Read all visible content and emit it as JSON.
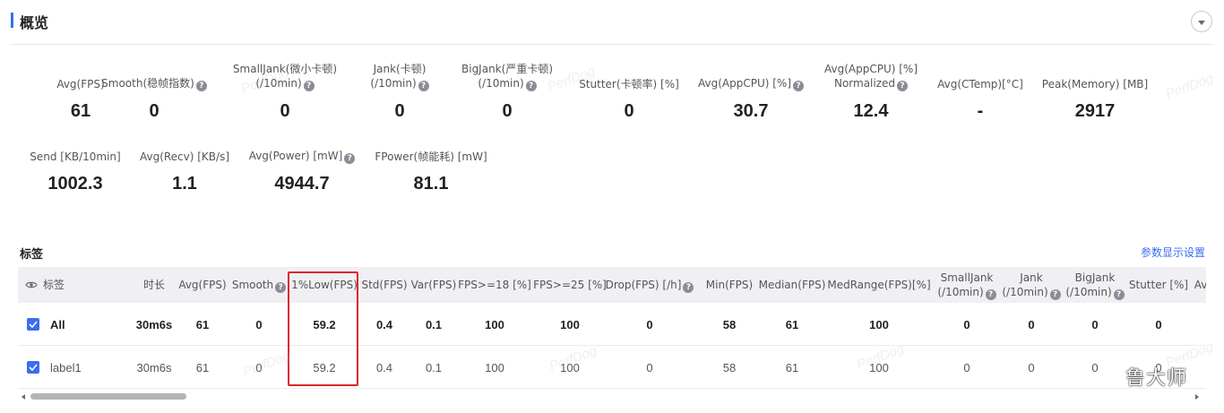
{
  "header": {
    "title": "概览"
  },
  "watermark": "PerfDog",
  "brand_mark": "鲁大师",
  "overview": {
    "row1": [
      {
        "label": [
          "Avg(FPS)"
        ],
        "help": false,
        "value": "61"
      },
      {
        "label": [
          "Smooth(稳帧指数)"
        ],
        "help": true,
        "value": "0"
      },
      {
        "label": [
          "SmallJank(微小卡顿)",
          "(/10min)"
        ],
        "help": true,
        "value": "0"
      },
      {
        "label": [
          "Jank(卡顿)",
          "(/10min)"
        ],
        "help": true,
        "value": "0"
      },
      {
        "label": [
          "BigJank(严重卡顿)",
          "(/10min)"
        ],
        "help": true,
        "value": "0"
      },
      {
        "label": [
          "Stutter(卡顿率) [%]"
        ],
        "help": false,
        "value": "0"
      },
      {
        "label": [
          "Avg(AppCPU) [%]"
        ],
        "help": true,
        "value": "30.7"
      },
      {
        "label": [
          "Avg(AppCPU) [%]",
          "Normalized"
        ],
        "help": true,
        "value": "12.4"
      },
      {
        "label": [
          "Avg(CTemp)[°C]"
        ],
        "help": false,
        "value": "-"
      },
      {
        "label": [
          "Peak(Memory) [MB]"
        ],
        "help": false,
        "value": "2917"
      }
    ],
    "row2": [
      {
        "label": [
          "Send [KB/10min]"
        ],
        "help": false,
        "value": "1002.3"
      },
      {
        "label": [
          "Avg(Recv) [KB/s]"
        ],
        "help": false,
        "value": "1.1"
      },
      {
        "label": [
          "Avg(Power) [mW]"
        ],
        "help": true,
        "value": "4944.7"
      },
      {
        "label": [
          "FPower(帧能耗) [mW]"
        ],
        "help": false,
        "value": "81.1"
      }
    ]
  },
  "labels_section": {
    "title": "标签",
    "settings_link": "参数显示设置",
    "columns": [
      {
        "label": [
          "标签"
        ],
        "help": false
      },
      {
        "label": [
          "时长"
        ],
        "help": false
      },
      {
        "label": [
          "Avg(FPS)"
        ],
        "help": false
      },
      {
        "label": [
          "Smooth"
        ],
        "help": true
      },
      {
        "label": [
          "1%Low(FPS)"
        ],
        "help": false
      },
      {
        "label": [
          "Std(FPS)"
        ],
        "help": false
      },
      {
        "label": [
          "Var(FPS)"
        ],
        "help": false
      },
      {
        "label": [
          "FPS>=18 [%]"
        ],
        "help": false
      },
      {
        "label": [
          "FPS>=25 [%]"
        ],
        "help": false
      },
      {
        "label": [
          "Drop(FPS) [/h]"
        ],
        "help": true
      },
      {
        "label": [
          "Min(FPS)"
        ],
        "help": false
      },
      {
        "label": [
          "Median(FPS)"
        ],
        "help": false
      },
      {
        "label": [
          "MedRange(FPS)[%]"
        ],
        "help": false
      },
      {
        "label": [
          "SmallJank",
          "(/10min)"
        ],
        "help": true
      },
      {
        "label": [
          "Jank",
          "(/10min)"
        ],
        "help": true
      },
      {
        "label": [
          "BigJank",
          "(/10min)"
        ],
        "help": true
      },
      {
        "label": [
          "Stutter [%]"
        ],
        "help": false
      },
      {
        "label": [
          "Av"
        ],
        "help": false
      }
    ],
    "rows": [
      {
        "checked": true,
        "bold": true,
        "cells": [
          "All",
          "30m6s",
          "61",
          "0",
          "59.2",
          "0.4",
          "0.1",
          "100",
          "100",
          "0",
          "58",
          "61",
          "100",
          "0",
          "0",
          "0",
          "0",
          ""
        ]
      },
      {
        "checked": true,
        "bold": false,
        "cells": [
          "label1",
          "30m6s",
          "61",
          "0",
          "59.2",
          "0.4",
          "0.1",
          "100",
          "100",
          "0",
          "58",
          "61",
          "100",
          "0",
          "0",
          "0",
          "0",
          ""
        ]
      }
    ]
  },
  "colors": {
    "accent": "#3a6df0",
    "highlight_box": "#e0242b",
    "header_bg": "#f0f0f4"
  }
}
